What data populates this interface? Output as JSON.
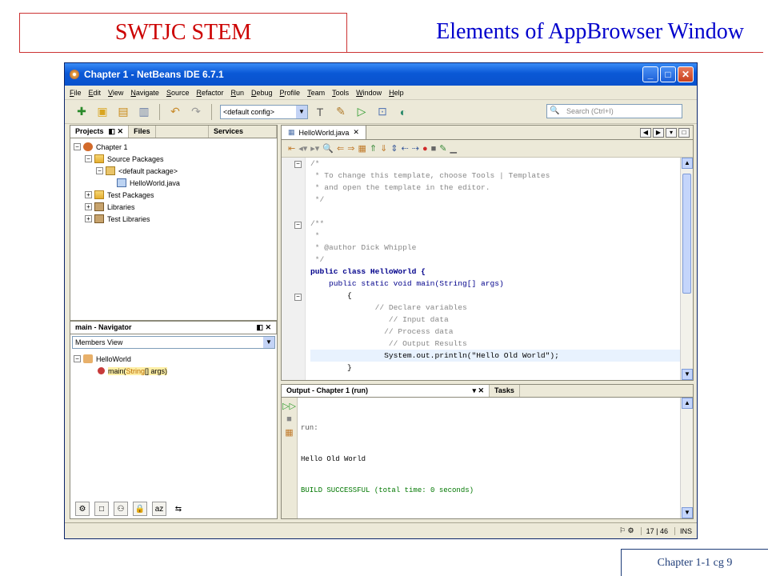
{
  "slide": {
    "left_title": "SWTJC STEM",
    "right_title": "Elements of AppBrowser Window",
    "footer": "Chapter 1-1 cg 9"
  },
  "window": {
    "title": "Chapter 1 - NetBeans IDE 6.7.1",
    "menu": [
      "File",
      "Edit",
      "View",
      "Navigate",
      "Source",
      "Refactor",
      "Run",
      "Debug",
      "Profile",
      "Team",
      "Tools",
      "Window",
      "Help"
    ],
    "config": "<default config>",
    "search_placeholder": "Search (Ctrl+I)"
  },
  "projects": {
    "tabs": [
      "Projects",
      "Files",
      "Services"
    ],
    "tree": [
      {
        "label": "Chapter 1",
        "level": 0,
        "icon": "project-icon"
      },
      {
        "label": "Source Packages",
        "level": 1,
        "icon": "folder-icon"
      },
      {
        "label": "<default package>",
        "level": 2,
        "icon": "package-icon"
      },
      {
        "label": "HelloWorld.java",
        "level": 3,
        "icon": "java-file-icon"
      },
      {
        "label": "Test Packages",
        "level": 1,
        "icon": "folder-icon"
      },
      {
        "label": "Libraries",
        "level": 1,
        "icon": "library-icon"
      },
      {
        "label": "Test Libraries",
        "level": 1,
        "icon": "library-icon"
      }
    ]
  },
  "navigator": {
    "title": "main - Navigator",
    "view": "Members View",
    "class_name": "HelloWorld",
    "method_name": "main",
    "method_params_type": "String",
    "method_params_rest": "[] args)"
  },
  "editor": {
    "tab": "HelloWorld.java",
    "lines": [
      "/*",
      " * To change this template, choose Tools | Templates",
      " * and open the template in the editor.",
      " */",
      "",
      "/**",
      " *",
      " * @author Dick Whipple",
      " */",
      "public class HelloWorld {",
      "    public static void main(String[] args)",
      "        {",
      "              // Declare variables",
      "                 // Input data",
      "                // Process data",
      "                 // Output Results",
      "                System.out.println(\"Hello Old World\");",
      "        }"
    ]
  },
  "output": {
    "tab": "Output - Chapter 1 (run)",
    "tab2": "Tasks",
    "line1": "run:",
    "line2": "Hello Old World",
    "line3": "BUILD SUCCESSFUL (total time: 0 seconds)"
  },
  "status": {
    "position": "17 | 46",
    "mode": "INS"
  }
}
